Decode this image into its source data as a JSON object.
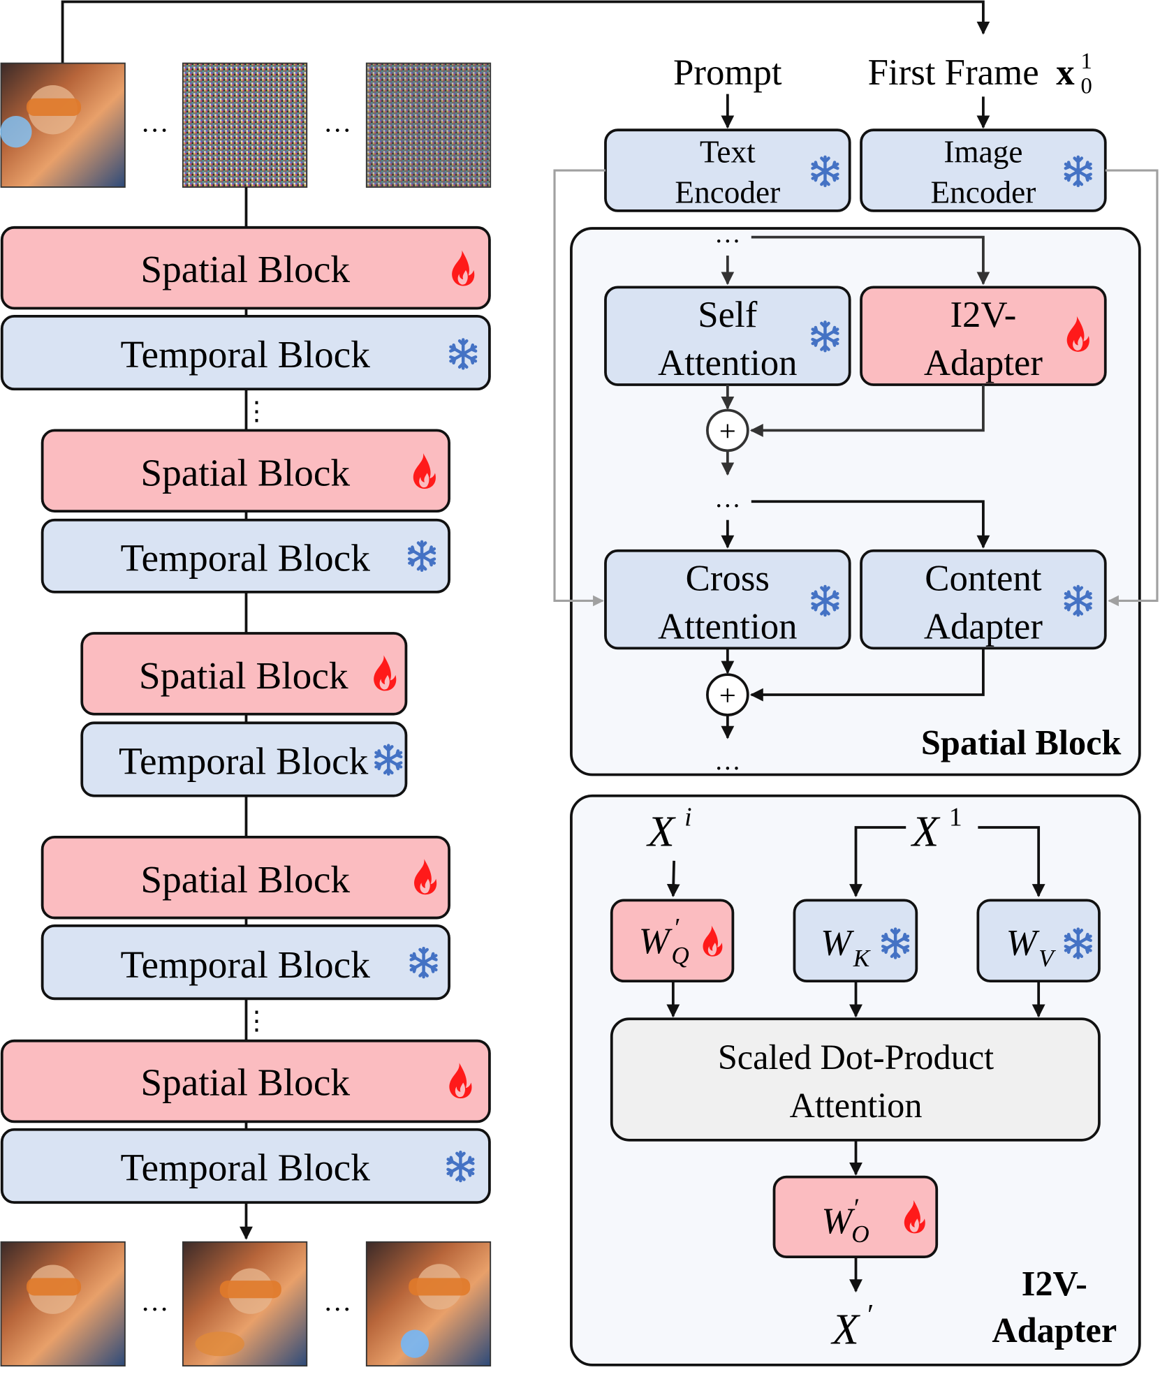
{
  "left_column": {
    "input_frames_ellipsis": [
      "…",
      "…"
    ],
    "output_frames_ellipsis": [
      "…",
      "…"
    ],
    "vertical_ellipsis": [
      "⋮",
      "⋮"
    ],
    "blocks": [
      {
        "type": "spatial",
        "label": "Spatial Block",
        "status": "trainable"
      },
      {
        "type": "temporal",
        "label": "Temporal Block",
        "status": "frozen"
      },
      {
        "type": "spatial",
        "label": "Spatial Block",
        "status": "trainable"
      },
      {
        "type": "temporal",
        "label": "Temporal Block",
        "status": "frozen"
      },
      {
        "type": "spatial",
        "label": "Spatial Block",
        "status": "trainable"
      },
      {
        "type": "temporal",
        "label": "Temporal Block",
        "status": "frozen"
      },
      {
        "type": "spatial",
        "label": "Spatial Block",
        "status": "trainable"
      },
      {
        "type": "temporal",
        "label": "Temporal Block",
        "status": "frozen"
      },
      {
        "type": "spatial",
        "label": "Spatial Block",
        "status": "trainable"
      },
      {
        "type": "temporal",
        "label": "Temporal Block",
        "status": "frozen"
      }
    ]
  },
  "inputs": {
    "prompt": "Prompt",
    "first_frame": "First Frame",
    "first_frame_symbol": "x",
    "first_frame_sup": "1",
    "first_frame_sub": "0"
  },
  "encoders": {
    "text": [
      "Text",
      "Encoder"
    ],
    "image": [
      "Image",
      "Encoder"
    ]
  },
  "spatial_block_panel": {
    "title": "Spatial Block",
    "self_attention": [
      "Self",
      "Attention"
    ],
    "i2v_adapter": [
      "I2V-",
      "Adapter"
    ],
    "cross_attention": [
      "Cross",
      "Attention"
    ],
    "content_adapter": [
      "Content",
      "Adapter"
    ],
    "ellipsis": "…",
    "plus": "+"
  },
  "i2v_adapter_panel": {
    "title": [
      "I2V-",
      "Adapter"
    ],
    "input_i": {
      "base": "X",
      "sup": "i"
    },
    "input_1": {
      "base": "X",
      "sup": "1"
    },
    "wq": {
      "base": "W",
      "prime": "′",
      "sub": "Q"
    },
    "wk": {
      "base": "W",
      "sub": "K"
    },
    "wv": {
      "base": "W",
      "sub": "V"
    },
    "attention": [
      "Scaled Dot-Product",
      "Attention"
    ],
    "wo": {
      "base": "W",
      "prime": "′",
      "sub": "O"
    },
    "output": {
      "base": "X",
      "prime": "′"
    }
  },
  "legend_icons": {
    "trainable": "fire-icon",
    "frozen": "snowflake-icon"
  },
  "colors": {
    "trainable_fill": "#fbbcc0",
    "frozen_fill": "#d9e3f3",
    "attention_fill": "#f0f0f0",
    "panel_fill": "#f6f8fc",
    "fire": "#ff0000",
    "snowflake": "#4472c4",
    "gray_connector": "#a0a0a0"
  }
}
